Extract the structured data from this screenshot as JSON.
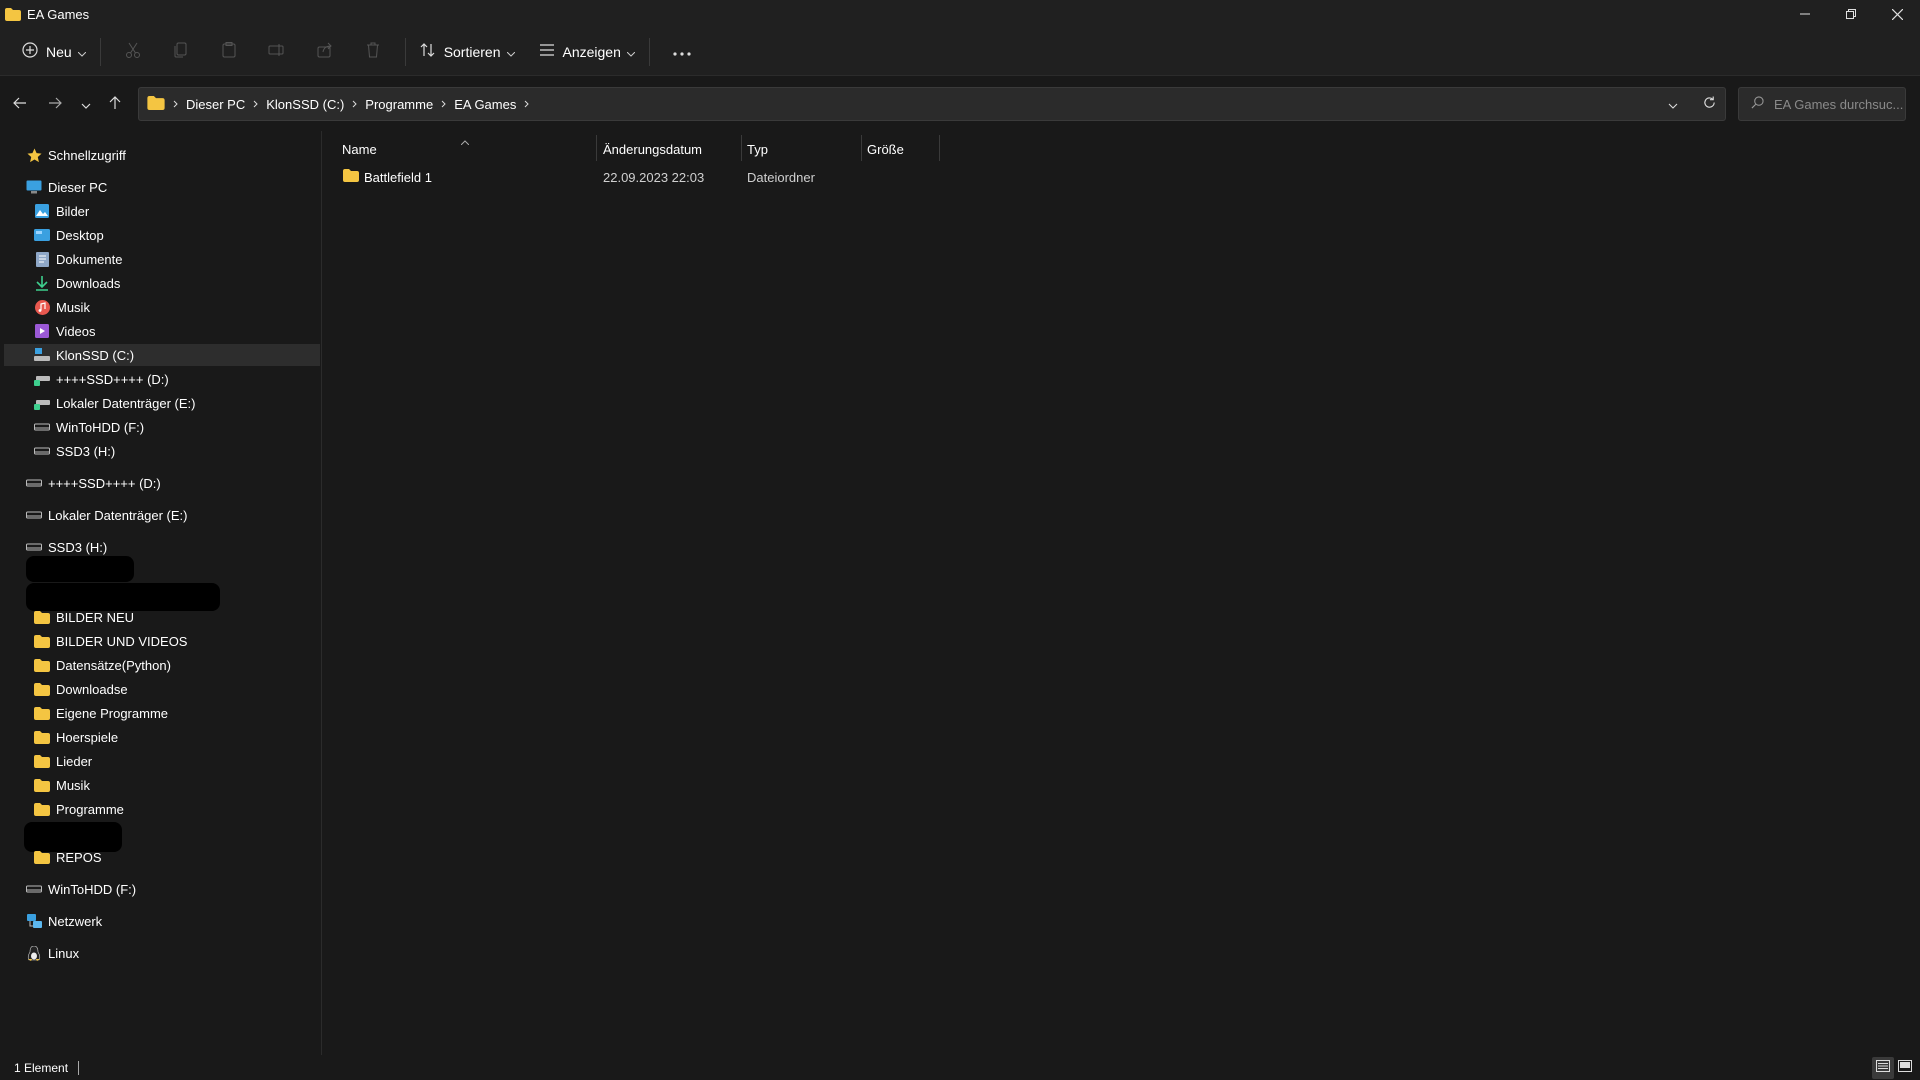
{
  "window": {
    "title": "EA Games"
  },
  "toolbar": {
    "new_label": "Neu",
    "sort_label": "Sortieren",
    "view_label": "Anzeigen"
  },
  "address": {
    "crumbs": [
      "Dieser PC",
      "KlonSSD (C:)",
      "Programme",
      "EA Games"
    ]
  },
  "search": {
    "placeholder": "EA Games durchsuc..."
  },
  "sidebar": {
    "quick_access": "Schnellzugriff",
    "this_pc": "Dieser PC",
    "pc_items": [
      "Bilder",
      "Desktop",
      "Dokumente",
      "Downloads",
      "Musik",
      "Videos",
      "KlonSSD (C:)",
      "++++SSD++++ (D:)",
      "Lokaler Datenträger (E:)",
      "WinToHDD (F:)",
      "SSD3 (H:)"
    ],
    "drives": [
      "++++SSD++++ (D:)",
      "Lokaler Datenträger (E:)",
      "SSD3 (H:)"
    ],
    "folders": [
      "BILDER NEU",
      "BILDER UND VIDEOS",
      "Datensätze(Python)",
      "Downloadse",
      "Eigene Programme",
      "Hoerspiele",
      "Lieder",
      "Musik",
      "Programme",
      "REPOS"
    ],
    "wintohdd": "WinToHDD (F:)",
    "network": "Netzwerk",
    "linux": "Linux"
  },
  "columns": {
    "name": "Name",
    "date": "Änderungsdatum",
    "type": "Typ",
    "size": "Größe"
  },
  "files": [
    {
      "name": "Battlefield 1",
      "date": "22.09.2023 22:03",
      "type": "Dateiordner",
      "size": ""
    }
  ],
  "status": {
    "count": "1 Element"
  },
  "colors": {
    "folder": "#f4c542",
    "background": "#191919",
    "panel": "#202020",
    "selected": "#2d2d2d"
  }
}
